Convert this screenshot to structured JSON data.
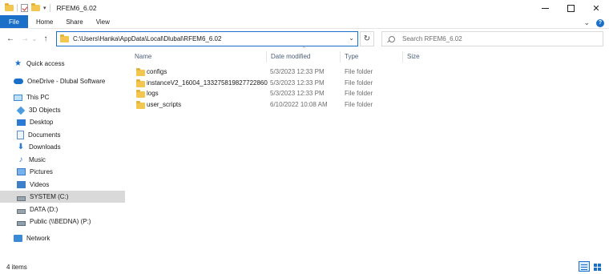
{
  "window": {
    "title": "RFEM6_6.02",
    "controls": {
      "minimize": "—",
      "maximize": "□",
      "close": "✕"
    }
  },
  "ribbon": {
    "tabs": [
      "File",
      "Home",
      "Share",
      "View"
    ],
    "expand_glyph": "⌄",
    "help_glyph": "?"
  },
  "navigation": {
    "back": "←",
    "forward": "→",
    "recent": "⌄",
    "up": "↑",
    "address_path": "C:\\Users\\Hanka\\AppData\\Local\\Dlubal\\RFEM6_6.02",
    "address_dropdown": "⌄",
    "refresh": "↻",
    "search_placeholder": "Search RFEM6_6.02"
  },
  "sidebar": {
    "items": [
      {
        "label": "Quick access",
        "icon": "star-icon"
      },
      {
        "label": "OneDrive - Dlubal Software",
        "icon": "cloud-icon"
      },
      {
        "label": "This PC",
        "icon": "computer-icon"
      },
      {
        "label": "3D Objects",
        "icon": "cube-icon"
      },
      {
        "label": "Desktop",
        "icon": "desktop-icon"
      },
      {
        "label": "Documents",
        "icon": "document-icon"
      },
      {
        "label": "Downloads",
        "icon": "download-icon"
      },
      {
        "label": "Music",
        "icon": "music-icon"
      },
      {
        "label": "Pictures",
        "icon": "pictures-icon"
      },
      {
        "label": "Videos",
        "icon": "video-icon"
      },
      {
        "label": "SYSTEM (C:)",
        "icon": "drive-icon",
        "selected": true
      },
      {
        "label": "DATA (D:)",
        "icon": "drive-icon"
      },
      {
        "label": "Public (\\\\BEDNA) (P:)",
        "icon": "network-drive-icon"
      },
      {
        "label": "Network",
        "icon": "network-icon"
      }
    ]
  },
  "file_list": {
    "columns": [
      "Name",
      "Date modified",
      "Type",
      "Size"
    ],
    "sort_indicator": "^",
    "rows": [
      {
        "name": "configs",
        "date": "5/3/2023 12:33 PM",
        "type": "File folder"
      },
      {
        "name": "instanceV2_16004_133275819827722860",
        "date": "5/3/2023 12:33 PM",
        "type": "File folder"
      },
      {
        "name": "logs",
        "date": "5/3/2023 12:33 PM",
        "type": "File folder"
      },
      {
        "name": "user_scripts",
        "date": "6/10/2022 10:08 AM",
        "type": "File folder"
      }
    ]
  },
  "status_bar": {
    "item_count": "4 items"
  },
  "colors": {
    "accent": "#1a6fc9",
    "folder": "#f3c74f",
    "selection": "#d9d9d9"
  }
}
